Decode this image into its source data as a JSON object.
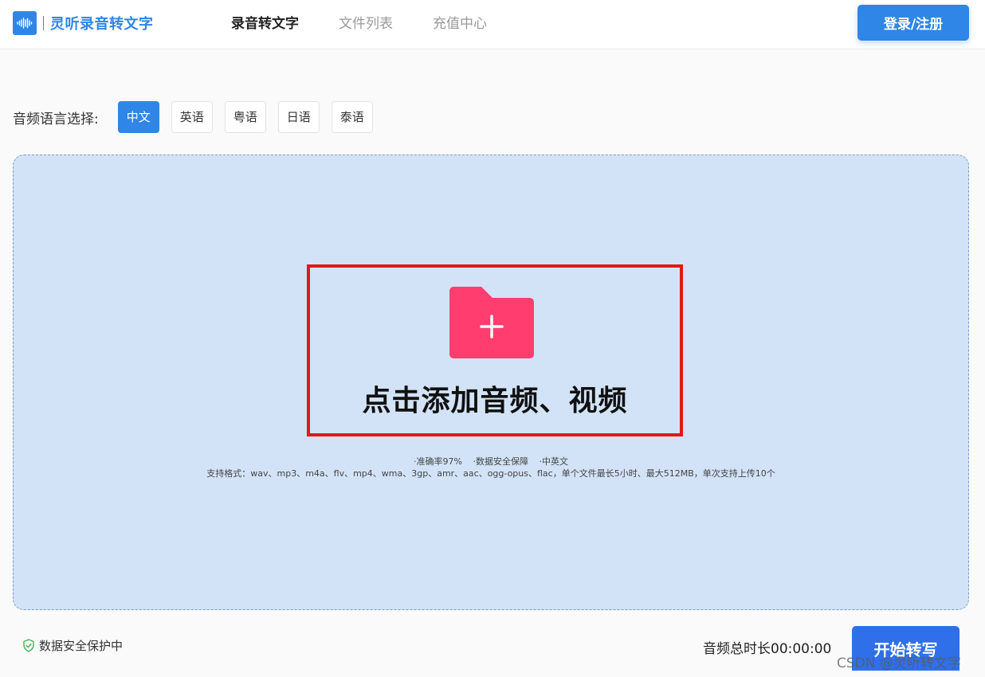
{
  "header": {
    "app_name": "灵听录音转文字",
    "logo_icon": "sound-wave-icon",
    "nav": [
      {
        "label": "录音转文字",
        "active": true
      },
      {
        "label": "文件列表",
        "active": false
      },
      {
        "label": "充值中心",
        "active": false
      }
    ],
    "login_label": "登录/注册"
  },
  "language": {
    "label": "音频语言选择:",
    "options": [
      {
        "label": "中文",
        "selected": true
      },
      {
        "label": "英语",
        "selected": false
      },
      {
        "label": "粤语",
        "selected": false
      },
      {
        "label": "日语",
        "selected": false
      },
      {
        "label": "泰语",
        "selected": false
      }
    ]
  },
  "upload": {
    "icon": "folder-plus-icon",
    "title": "点击添加音频、视频",
    "features": [
      "·准确率97%",
      "·数据安全保障",
      "·中英文"
    ],
    "formats": "支持格式：wav、mp3、m4a、flv、mp4、wma、3gp、amr、aac、ogg-opus、flac，单个文件最长5小时、最大512MB，单次支持上传10个"
  },
  "footer": {
    "security_text": "数据安全保护中",
    "duration_text": "音频总时长00:00:00",
    "start_label": "开始转写",
    "watermark": "CSDN @灵听转文字"
  },
  "colors": {
    "brand": "#2f86e6",
    "folder": "#ff3d6e",
    "dropzone": "#d2e3f7",
    "highlight": "#e01919"
  }
}
